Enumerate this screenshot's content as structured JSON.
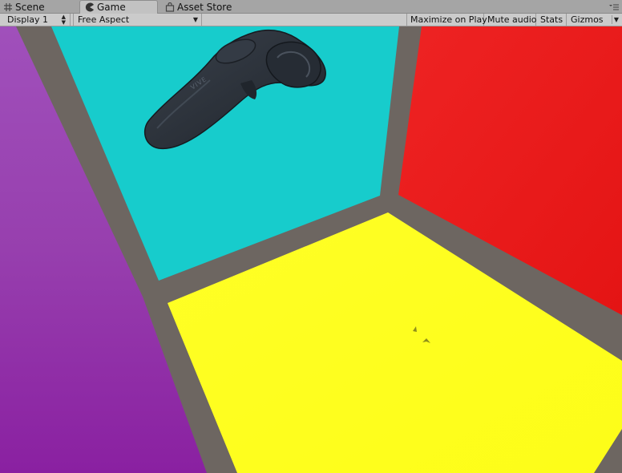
{
  "tabs": [
    {
      "label": "Scene",
      "icon": "grid-icon",
      "active": false
    },
    {
      "label": "Game",
      "icon": "pacman-icon",
      "active": true
    },
    {
      "label": "Asset Store",
      "icon": "shopping-bag-icon",
      "active": false
    }
  ],
  "toolbar": {
    "display_label": "Display 1",
    "aspect_label": "Free Aspect",
    "maximize_label": "Maximize on Play",
    "mute_label": "Mute audio",
    "stats_label": "Stats",
    "gizmos_label": "Gizmos"
  },
  "scene": {
    "colors": {
      "back_wall": "#17cccc",
      "right_wall": "#ea1c1c",
      "left_wall": "#9a3bb1",
      "floor": "#ffff22",
      "frame": "#6d6661",
      "controller": "#2b3139"
    },
    "controller_brand": "VIVE"
  }
}
